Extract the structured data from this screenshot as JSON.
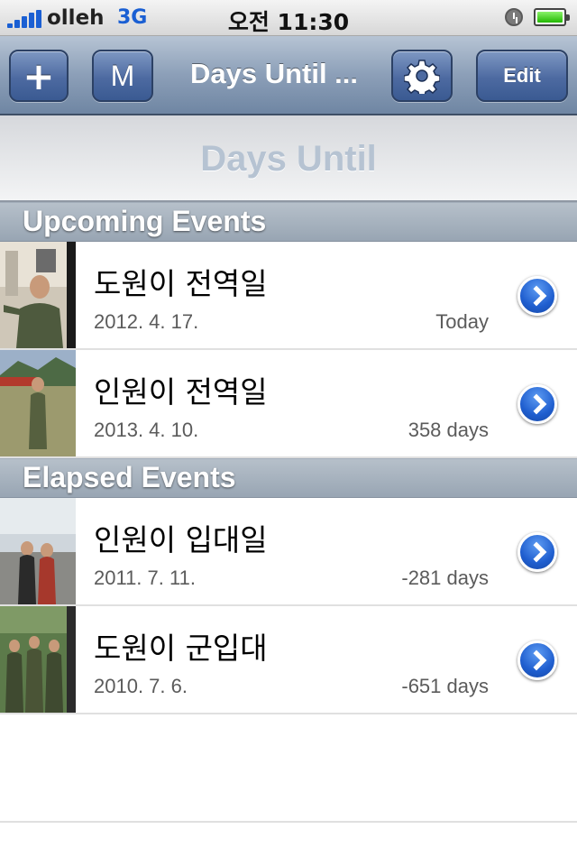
{
  "status_bar": {
    "carrier": "olleh",
    "network": "3G",
    "time": "오전 11:30"
  },
  "nav": {
    "add_label": "+",
    "m_label": "M",
    "title": "Days Until ...",
    "edit_label": "Edit",
    "settings_icon": "gear-icon"
  },
  "header": {
    "title": "Days Until"
  },
  "sections": {
    "upcoming": "Upcoming Events",
    "elapsed": "Elapsed Events"
  },
  "upcoming_events": [
    {
      "title": "도원이 전역일",
      "date": "2012. 4. 17.",
      "count": "Today"
    },
    {
      "title": "인원이 전역일",
      "date": "2013. 4. 10.",
      "count": "358 days"
    }
  ],
  "elapsed_events": [
    {
      "title": "인원이 입대일",
      "date": "2011. 7. 11.",
      "count": "-281 days"
    },
    {
      "title": "도원이 군입대",
      "date": "2010. 7. 6.",
      "count": "-651 days"
    }
  ],
  "colors": {
    "nav_button": "#4d6aa1",
    "disclosure": "#1f5ecf",
    "section_header": "#98a5b3"
  }
}
